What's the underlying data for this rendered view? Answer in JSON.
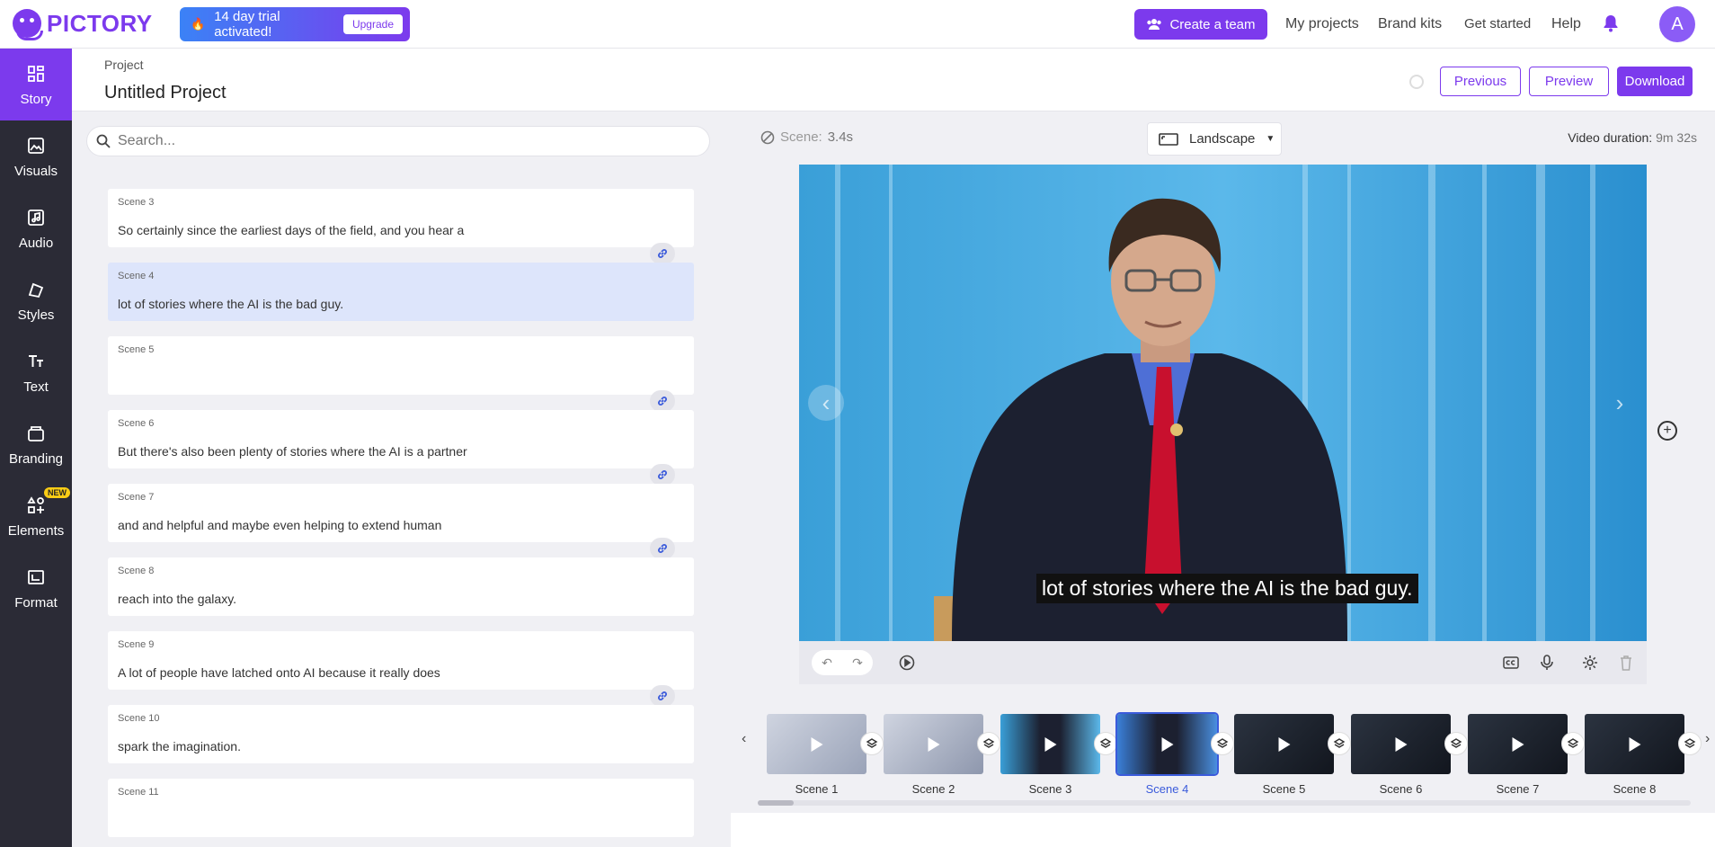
{
  "brand": {
    "name": "PICTORY",
    "accent": "#7c3aed"
  },
  "trial": {
    "text": "14 day trial activated!",
    "upgrade_label": "Upgrade"
  },
  "topnav": {
    "create_team": "Create a team",
    "links": [
      "My projects",
      "Brand kits",
      "Get started",
      "Help"
    ],
    "avatar_initial": "A"
  },
  "sidebar": {
    "items": [
      {
        "label": "Story",
        "icon": "story-icon",
        "active": true
      },
      {
        "label": "Visuals",
        "icon": "visuals-icon"
      },
      {
        "label": "Audio",
        "icon": "audio-icon"
      },
      {
        "label": "Styles",
        "icon": "styles-icon"
      },
      {
        "label": "Text",
        "icon": "text-icon"
      },
      {
        "label": "Branding",
        "icon": "branding-icon"
      },
      {
        "label": "Elements",
        "icon": "elements-icon",
        "badge": "NEW"
      },
      {
        "label": "Format",
        "icon": "format-icon"
      }
    ]
  },
  "project": {
    "label": "Project",
    "title": "Untitled Project",
    "previous_label": "Previous",
    "preview_label": "Preview",
    "download_label": "Download"
  },
  "story": {
    "search_placeholder": "Search...",
    "scenes": [
      {
        "label": "Scene 3",
        "text": "So certainly since the earliest days of the field, and you hear a"
      },
      {
        "label": "Scene 4",
        "text": "lot of stories where the AI is the bad guy.",
        "active": true
      },
      {
        "label": "Scene 5",
        "text": ""
      },
      {
        "label": "Scene 6",
        "text": "But there's also been plenty of stories where the AI is a partner"
      },
      {
        "label": "Scene 7",
        "text": "and and helpful and maybe even helping to extend human"
      },
      {
        "label": "Scene 8",
        "text": "reach into the galaxy."
      },
      {
        "label": "Scene 9",
        "text": "A lot of people have latched onto AI because it really does"
      },
      {
        "label": "Scene 10",
        "text": "spark the imagination."
      },
      {
        "label": "Scene 11",
        "text": ""
      }
    ]
  },
  "preview": {
    "scene_label": "Scene:",
    "scene_duration": "3.4s",
    "orientation": "Landscape",
    "video_duration_label": "Video duration:",
    "video_duration": "9m 32s",
    "caption": "lot of stories where the AI is the bad guy."
  },
  "timeline": {
    "scenes": [
      "Scene 1",
      "Scene 2",
      "Scene 3",
      "Scene 4",
      "Scene 5",
      "Scene 6",
      "Scene 7",
      "Scene 8"
    ],
    "active_index": 3
  }
}
